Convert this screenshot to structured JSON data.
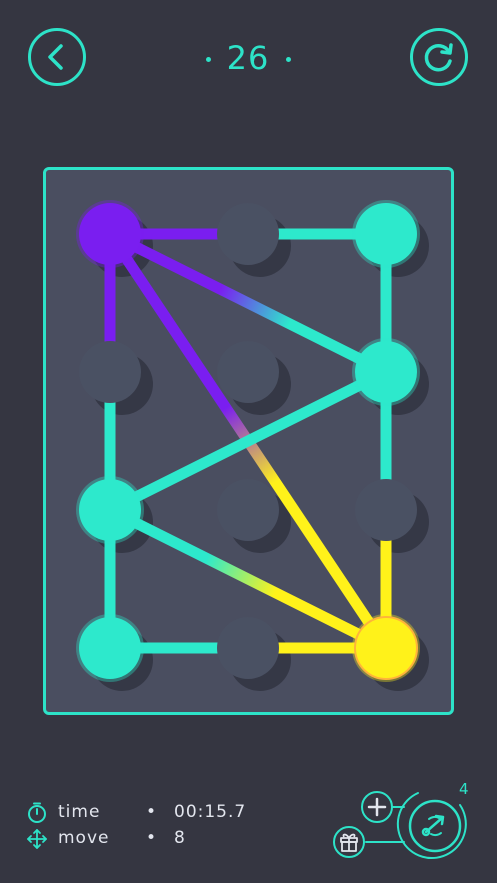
{
  "level": "26",
  "stats": {
    "time_label": "time",
    "time_value": "00:15.7",
    "move_label": "move",
    "move_value": "8",
    "separator": "•"
  },
  "hint_count": "4",
  "icons": {
    "back": "chevron-left-icon",
    "reset": "rotate-icon",
    "timer": "stopwatch-icon",
    "move": "move-arrows-icon",
    "add": "plus-icon",
    "gift": "gift-icon",
    "hint": "swap-hint-icon"
  },
  "colors": {
    "background": "#353641",
    "accent": "#2de3c8",
    "board": "#4a4e60",
    "node_empty": "#4a5163",
    "teal": "#2de9cc",
    "purple": "#7a1ef0",
    "yellow": "#fff21a"
  },
  "board": {
    "cols": 3,
    "rows": 4,
    "nodes": [
      {
        "col": 0,
        "row": 0,
        "state": "purple"
      },
      {
        "col": 1,
        "row": 0,
        "state": "empty"
      },
      {
        "col": 2,
        "row": 0,
        "state": "teal"
      },
      {
        "col": 0,
        "row": 1,
        "state": "empty"
      },
      {
        "col": 1,
        "row": 1,
        "state": "empty"
      },
      {
        "col": 2,
        "row": 1,
        "state": "teal"
      },
      {
        "col": 0,
        "row": 2,
        "state": "teal"
      },
      {
        "col": 1,
        "row": 2,
        "state": "empty"
      },
      {
        "col": 2,
        "row": 2,
        "state": "empty"
      },
      {
        "col": 0,
        "row": 3,
        "state": "teal"
      },
      {
        "col": 1,
        "row": 3,
        "state": "empty"
      },
      {
        "col": 2,
        "row": 3,
        "state": "yellow"
      }
    ],
    "edges": [
      {
        "from": [
          0,
          0
        ],
        "to": [
          2,
          0
        ],
        "colors": [
          "purple",
          "purple",
          "teal"
        ],
        "stops": [
          0,
          0.45,
          0.5
        ]
      },
      {
        "from": [
          0,
          0
        ],
        "to": [
          2,
          1
        ],
        "colors": [
          "purple",
          "teal"
        ],
        "stops": [
          0.4,
          0.65
        ]
      },
      {
        "from": [
          0,
          0
        ],
        "to": [
          2,
          3
        ],
        "colors": [
          "purple",
          "yellow"
        ],
        "stops": [
          0.42,
          0.6
        ]
      },
      {
        "from": [
          0,
          0
        ],
        "to": [
          0,
          2
        ],
        "colors": [
          "purple",
          "teal"
        ],
        "stops": [
          0.45,
          0.55
        ]
      },
      {
        "from": [
          2,
          0
        ],
        "to": [
          2,
          1
        ],
        "colors": [
          "teal",
          "teal"
        ],
        "stops": [
          0,
          1
        ]
      },
      {
        "from": [
          2,
          1
        ],
        "to": [
          2,
          2
        ],
        "colors": [
          "teal",
          "teal"
        ],
        "stops": [
          0,
          1
        ]
      },
      {
        "from": [
          2,
          2
        ],
        "to": [
          2,
          3
        ],
        "colors": [
          "yellow",
          "yellow"
        ],
        "stops": [
          0,
          1
        ]
      },
      {
        "from": [
          2,
          1
        ],
        "to": [
          0,
          2
        ],
        "colors": [
          "teal",
          "teal"
        ],
        "stops": [
          0,
          1
        ]
      },
      {
        "from": [
          0,
          2
        ],
        "to": [
          0,
          3
        ],
        "colors": [
          "teal",
          "teal"
        ],
        "stops": [
          0,
          1
        ]
      },
      {
        "from": [
          0,
          2
        ],
        "to": [
          2,
          3
        ],
        "colors": [
          "teal",
          "yellow"
        ],
        "stops": [
          0.35,
          0.6
        ]
      },
      {
        "from": [
          0,
          3
        ],
        "to": [
          2,
          3
        ],
        "colors": [
          "teal",
          "teal",
          "yellow"
        ],
        "stops": [
          0,
          0.5,
          0.55
        ]
      }
    ]
  }
}
